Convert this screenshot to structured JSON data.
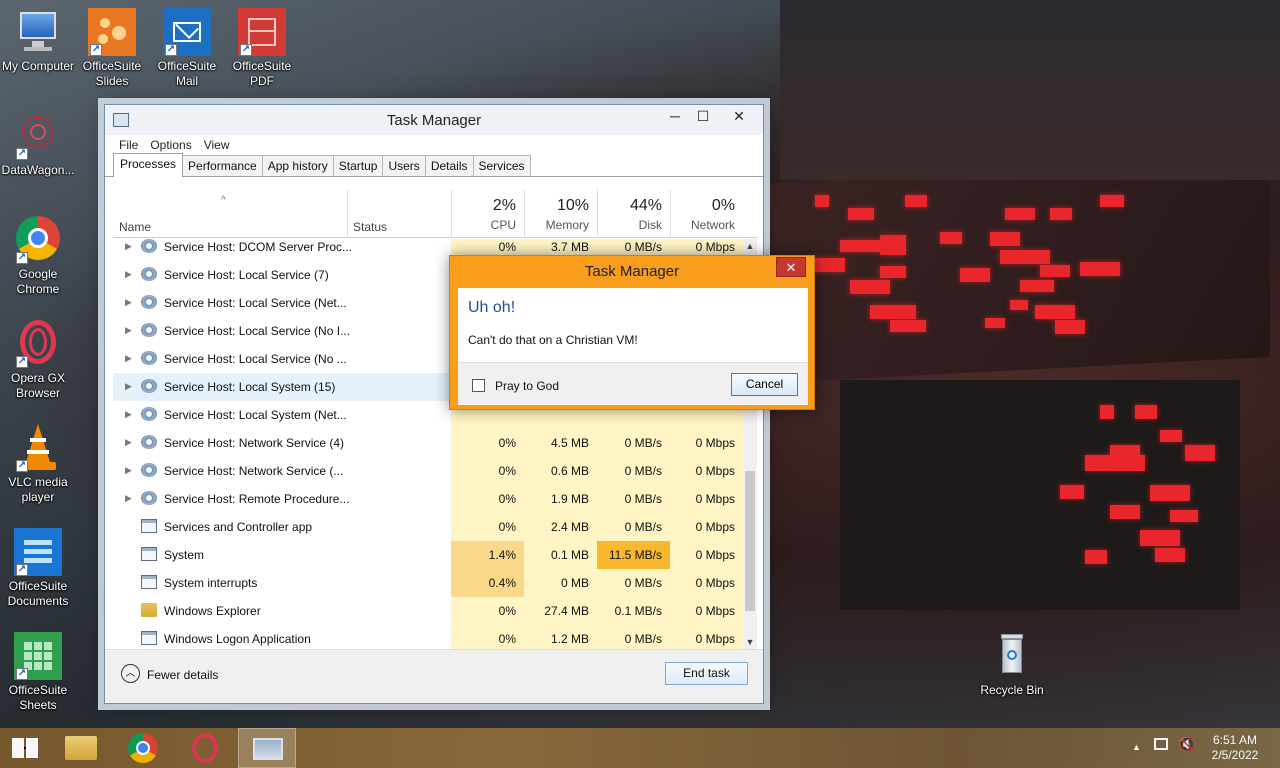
{
  "desktop": {
    "icons": [
      {
        "label": "My Computer",
        "icon": "my-computer-icon"
      },
      {
        "label": "OfficeSuite Slides",
        "icon": "officesuite-slides-icon"
      },
      {
        "label": "OfficeSuite Mail",
        "icon": "officesuite-mail-icon"
      },
      {
        "label": "OfficeSuite PDF",
        "icon": "officesuite-pdf-icon"
      },
      {
        "label": "DataWagon...",
        "icon": "datawagon-icon"
      },
      {
        "label": "Google Chrome",
        "icon": "chrome-icon"
      },
      {
        "label": "Opera GX Browser",
        "icon": "opera-gx-icon"
      },
      {
        "label": "VLC media player",
        "icon": "vlc-icon"
      },
      {
        "label": "OfficeSuite Documents",
        "icon": "officesuite-documents-icon"
      },
      {
        "label": "OfficeSuite Sheets",
        "icon": "officesuite-sheets-icon"
      },
      {
        "label": "Recycle Bin",
        "icon": "recycle-bin-icon"
      }
    ]
  },
  "task_manager": {
    "title": "Task Manager",
    "menu": [
      "File",
      "Options",
      "View"
    ],
    "tabs": [
      "Processes",
      "Performance",
      "App history",
      "Startup",
      "Users",
      "Details",
      "Services"
    ],
    "active_tab": "Processes",
    "columns": {
      "name": "Name",
      "status": "Status",
      "cpu": {
        "pct": "2%",
        "label": "CPU"
      },
      "memory": {
        "pct": "10%",
        "label": "Memory"
      },
      "disk": {
        "pct": "44%",
        "label": "Disk"
      },
      "network": {
        "pct": "0%",
        "label": "Network"
      }
    },
    "rows": [
      {
        "name": "Service Host: DCOM Server Proc...",
        "cpu": "0%",
        "mem": "3.7 MB",
        "disk": "0 MB/s",
        "net": "0 Mbps",
        "expand": true,
        "icon": "gear"
      },
      {
        "name": "Service Host: Local Service (7)",
        "cpu": "",
        "mem": "",
        "disk": "",
        "net": "",
        "expand": true,
        "icon": "gear"
      },
      {
        "name": "Service Host: Local Service (Net...",
        "cpu": "",
        "mem": "",
        "disk": "",
        "net": "",
        "expand": true,
        "icon": "gear"
      },
      {
        "name": "Service Host: Local Service (No I...",
        "cpu": "",
        "mem": "",
        "disk": "",
        "net": "",
        "expand": true,
        "icon": "gear"
      },
      {
        "name": "Service Host: Local Service (No ...",
        "cpu": "",
        "mem": "",
        "disk": "",
        "net": "",
        "expand": true,
        "icon": "gear"
      },
      {
        "name": "Service Host: Local System (15)",
        "cpu": "",
        "mem": "",
        "disk": "",
        "net": "",
        "expand": true,
        "icon": "gear",
        "highlight": true
      },
      {
        "name": "Service Host: Local System (Net...",
        "cpu": "",
        "mem": "",
        "disk": "",
        "net": "",
        "expand": true,
        "icon": "gear"
      },
      {
        "name": "Service Host: Network Service (4)",
        "cpu": "0%",
        "mem": "4.5 MB",
        "disk": "0 MB/s",
        "net": "0 Mbps",
        "expand": true,
        "icon": "gear"
      },
      {
        "name": "Service Host: Network Service (...",
        "cpu": "0%",
        "mem": "0.6 MB",
        "disk": "0 MB/s",
        "net": "0 Mbps",
        "expand": true,
        "icon": "gear"
      },
      {
        "name": "Service Host: Remote Procedure...",
        "cpu": "0%",
        "mem": "1.9 MB",
        "disk": "0 MB/s",
        "net": "0 Mbps",
        "expand": true,
        "icon": "gear"
      },
      {
        "name": "Services and Controller app",
        "cpu": "0%",
        "mem": "2.4 MB",
        "disk": "0 MB/s",
        "net": "0 Mbps",
        "expand": false,
        "icon": "win"
      },
      {
        "name": "System",
        "cpu": "1.4%",
        "mem": "0.1 MB",
        "disk": "11.5 MB/s",
        "net": "0 Mbps",
        "expand": false,
        "icon": "win",
        "cpu_hot": true,
        "disk_hot": true
      },
      {
        "name": "System interrupts",
        "cpu": "0.4%",
        "mem": "0 MB",
        "disk": "0 MB/s",
        "net": "0 Mbps",
        "expand": false,
        "icon": "win",
        "cpu_hot": true
      },
      {
        "name": "Windows Explorer",
        "cpu": "0%",
        "mem": "27.4 MB",
        "disk": "0.1 MB/s",
        "net": "0 Mbps",
        "expand": false,
        "icon": "folder"
      },
      {
        "name": "Windows Logon Application",
        "cpu": "0%",
        "mem": "1.2 MB",
        "disk": "0 MB/s",
        "net": "0 Mbps",
        "expand": false,
        "icon": "win"
      }
    ],
    "footer": {
      "fewer_details": "Fewer details",
      "end_task": "End task"
    }
  },
  "dialog": {
    "title": "Task Manager",
    "heading": "Uh oh!",
    "message": "Can't do that on a Christian VM!",
    "checkbox_label": "Pray to God",
    "cancel": "Cancel",
    "close": "✕"
  },
  "taskbar": {
    "time": "6:51 AM",
    "date": "2/5/2022",
    "apps": [
      "start-button",
      "file-explorer",
      "chrome",
      "opera",
      "task-manager"
    ]
  },
  "colors": {
    "dialog_orange": "#f99d1c",
    "heat_light": "#fff4c4",
    "heat_medium": "#f9d88a",
    "heat_high": "#f7b830",
    "ore_red": "#e8262b"
  }
}
